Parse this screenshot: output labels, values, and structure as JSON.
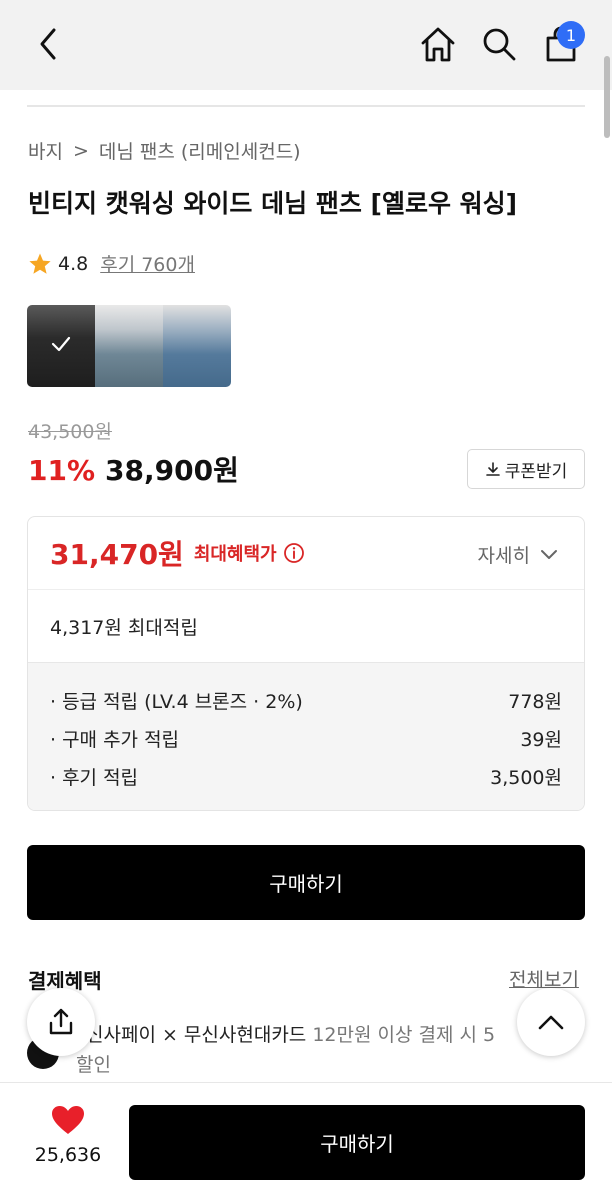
{
  "header": {
    "icons": [
      "chevron-left-icon",
      "home-icon",
      "search-icon",
      "shopping-bag-icon"
    ],
    "cart_badge": "1",
    "badge_color": "#2f6df6"
  },
  "breadcrumb": {
    "category": "바지",
    "separator": ">",
    "subcategory": "데님 팬츠 (리메인세컨드)"
  },
  "product": {
    "title": "빈티지 캣워싱 와이드 데님 팬츠 [옐로우 워싱]",
    "rating": "4.8",
    "reviews_label": "후기 760개",
    "original_price": "43,500원",
    "discount_rate": "11%",
    "price": "38,900원",
    "coupon_label": "쿠폰받기",
    "accent_color": "#e02020",
    "thumbnails": [
      "black-denim",
      "grey-washed-denim",
      "blue-washed-denim"
    ],
    "selected_thumbnail": 0
  },
  "benefit": {
    "max_price": "31,470원",
    "max_label": "최대혜택가",
    "detail_label": "자세히",
    "points_summary": "4,317원 최대적립",
    "rows": [
      {
        "label": "· 등급 적립 (LV.4 브론즈 · 2%)",
        "value": "778원"
      },
      {
        "label": "· 구매 추가 적립",
        "value": "39원"
      },
      {
        "label": "· 후기 적립",
        "value": "3,500원"
      }
    ]
  },
  "buy_button_label": "구매하기",
  "payment": {
    "title": "결제혜택",
    "view_all": "전체보기",
    "desc_main": "신사페이 × 무신사현대카드",
    "desc_sub": " 12만원 이상 결제 시 5",
    "desc_line2": "할인"
  },
  "bottom": {
    "like_count": "25,636",
    "buy_label": "구매하기",
    "heart_color": "#e8202a"
  }
}
